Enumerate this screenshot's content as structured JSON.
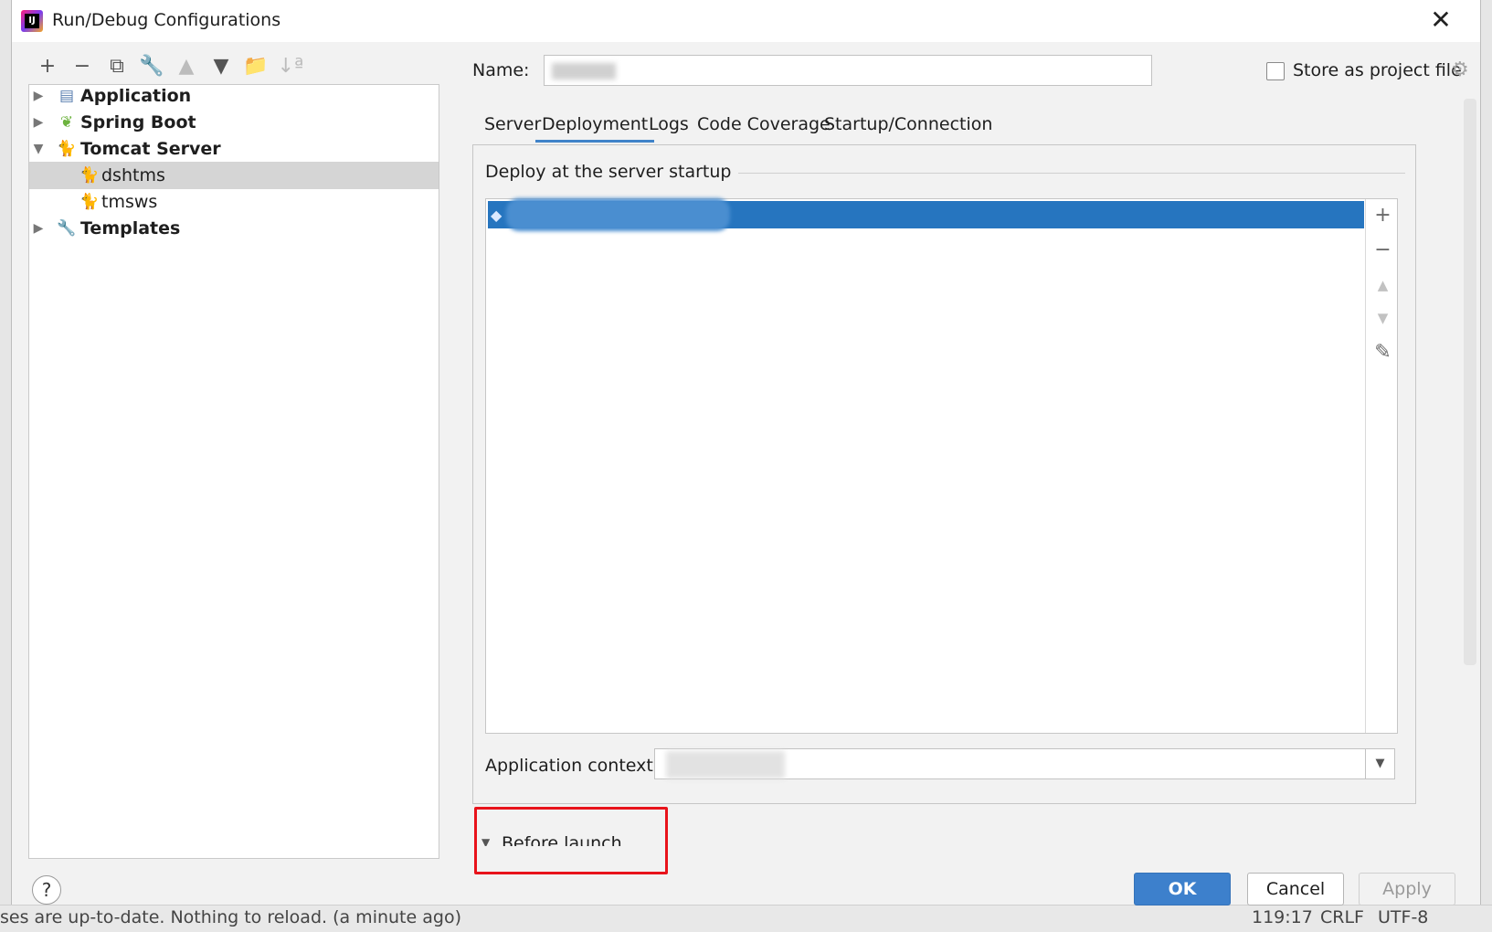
{
  "window": {
    "title": "Run/Debug Configurations",
    "close_glyph": "✕"
  },
  "toolbar": {
    "add": "+",
    "remove": "−",
    "copy": "⧉",
    "edit_defaults": "🔧",
    "move_up": "▲",
    "move_down": "▼",
    "new_folder": "📁",
    "sort": "↓ª"
  },
  "tree": {
    "items": [
      {
        "label": "Application",
        "expanded": false,
        "icon": "application-icon"
      },
      {
        "label": "Spring Boot",
        "expanded": false,
        "icon": "spring-boot-icon"
      },
      {
        "label": "Tomcat Server",
        "expanded": true,
        "icon": "tomcat-icon"
      },
      {
        "label": "dshtms",
        "selected": true,
        "icon": "tomcat-icon"
      },
      {
        "label": "tmsws",
        "icon": "tomcat-icon"
      },
      {
        "label": "Templates",
        "expanded": false,
        "icon": "wrench-icon"
      }
    ],
    "arrow_collapsed": "▶",
    "arrow_expanded": "▼"
  },
  "form": {
    "name_label": "Name:",
    "store_label": "Store as project file",
    "store_checked": false
  },
  "tabs": [
    "Server",
    "Deployment",
    "Logs",
    "Code Coverage",
    "Startup/Connection"
  ],
  "active_tab": "Deployment",
  "deployment": {
    "section_title": "Deploy at the server startup",
    "add": "+",
    "remove": "−",
    "up": "▲",
    "down": "▼",
    "edit": "✎",
    "context_label": "Application context:",
    "dropdown_glyph": "▼"
  },
  "before_launch": {
    "label": "Before launch",
    "arrow": "▼"
  },
  "buttons": {
    "ok": "OK",
    "cancel": "Cancel",
    "apply": "Apply",
    "help": "?"
  },
  "status_bar": {
    "message": "ses are up-to-date. Nothing to reload. (a minute ago)",
    "position": "119:17",
    "line_sep": "CRLF",
    "encoding": "UTF-8"
  },
  "colors": {
    "accent": "#3d80cc",
    "selection": "#2675bf",
    "highlight_box": "#e8131b"
  }
}
